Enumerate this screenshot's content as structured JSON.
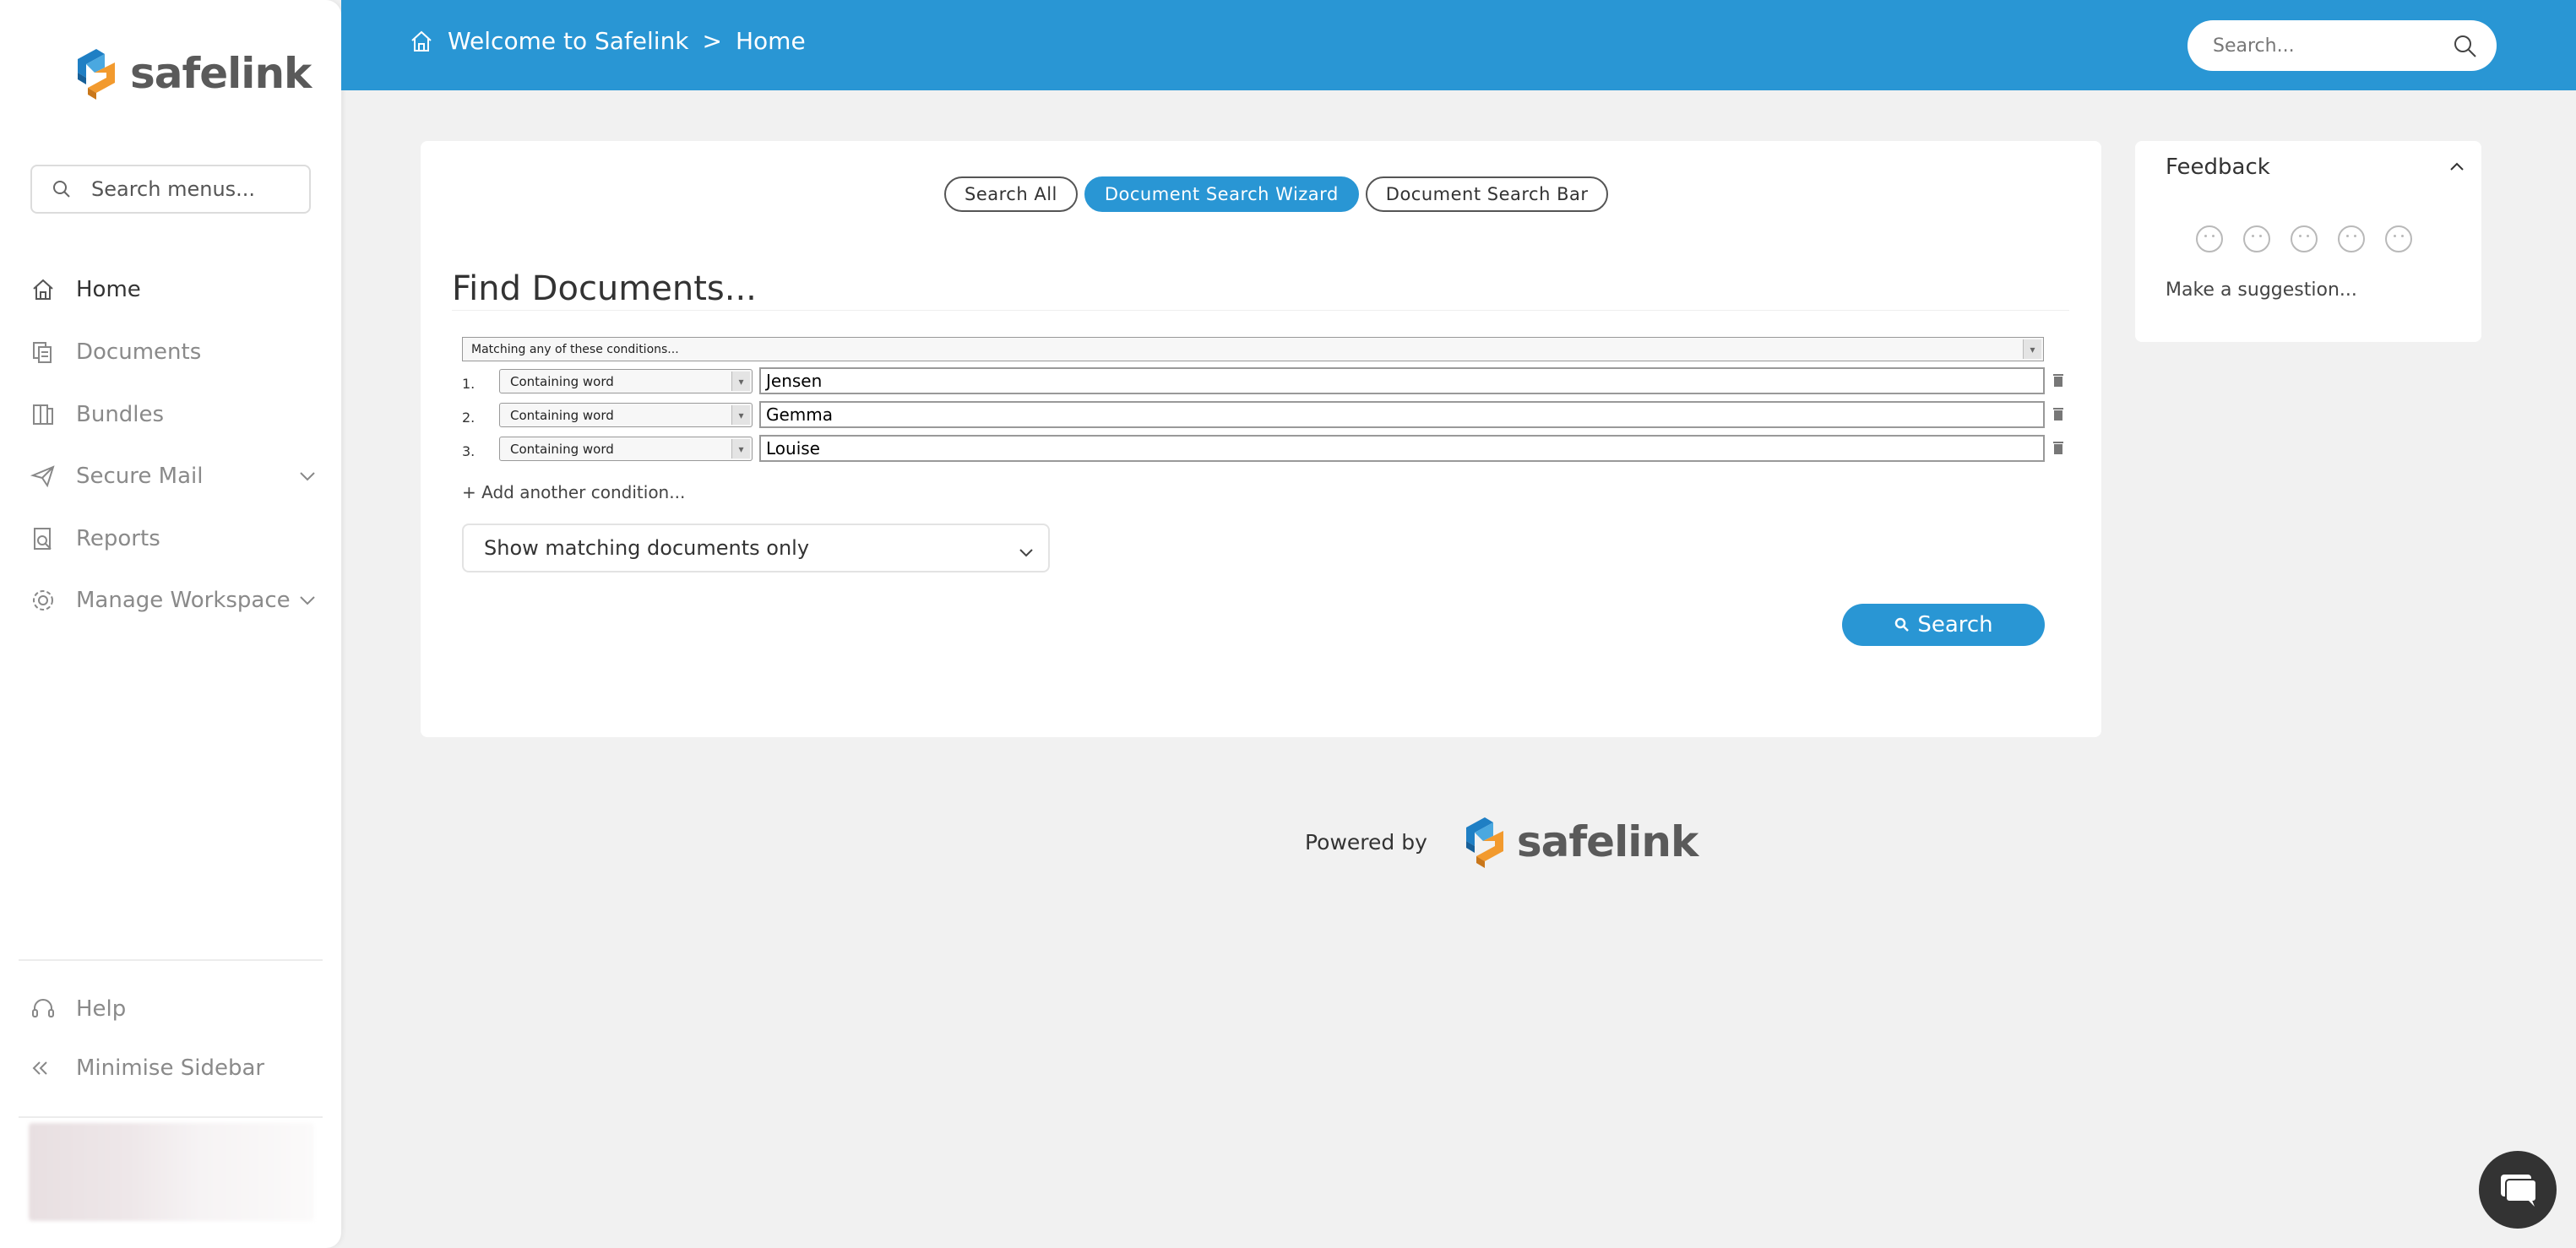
{
  "brand": {
    "name": "safelink",
    "colors": {
      "accent": "#2996d4",
      "logo_blue": "#1f7fc4",
      "logo_orange": "#f29a2e"
    }
  },
  "sidebar": {
    "search_placeholder": "Search menus...",
    "items": [
      {
        "label": "Home",
        "icon": "home-icon",
        "active": true
      },
      {
        "label": "Documents",
        "icon": "documents-icon"
      },
      {
        "label": "Bundles",
        "icon": "bundles-icon"
      },
      {
        "label": "Secure Mail",
        "icon": "send-icon",
        "expandable": true
      },
      {
        "label": "Reports",
        "icon": "reports-icon"
      },
      {
        "label": "Manage Workspace",
        "icon": "gear-icon",
        "expandable": true
      }
    ],
    "footer": [
      {
        "label": "Help",
        "icon": "headset-icon"
      },
      {
        "label": "Minimise Sidebar",
        "icon": "double-chevron-left-icon"
      }
    ]
  },
  "header": {
    "breadcrumb": [
      "Welcome to Safelink",
      ">",
      "Home"
    ],
    "search_placeholder": "Search..."
  },
  "main": {
    "tabs": [
      {
        "label": "Search All"
      },
      {
        "label": "Document Search Wizard",
        "active": true
      },
      {
        "label": "Document Search Bar"
      }
    ],
    "title": "Find Documents...",
    "match_mode": "Matching any of these conditions...",
    "conditions": [
      {
        "num": "1.",
        "type": "Containing word",
        "value": "Jensen"
      },
      {
        "num": "2.",
        "type": "Containing word",
        "value": "Gemma"
      },
      {
        "num": "3.",
        "type": "Containing word",
        "value": "Louise"
      }
    ],
    "add_condition": "+ Add another condition...",
    "show_option": "Show matching documents only",
    "search_button": "Search"
  },
  "feedback": {
    "title": "Feedback",
    "faces": [
      "very-sad",
      "sad",
      "neutral",
      "happy",
      "very-happy"
    ],
    "suggestion": "Make a suggestion..."
  },
  "footer": {
    "powered_by": "Powered by"
  }
}
